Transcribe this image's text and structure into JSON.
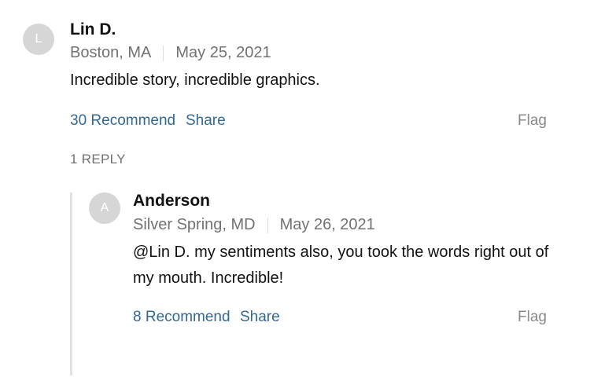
{
  "comment": {
    "avatar_initial": "L",
    "author": "Lin D.",
    "location": "Boston, MA",
    "date": "May 25, 2021",
    "text": "Incredible story, incredible graphics.",
    "recommend_label": "30 Recommend",
    "share_label": "Share",
    "flag_label": "Flag",
    "replies_label": "1 REPLY"
  },
  "reply": {
    "avatar_initial": "A",
    "author": "Anderson",
    "location": "Silver Spring, MD",
    "date": "May 26, 2021",
    "text": "@Lin D. my sentiments also, you took the words right out of my mouth.  Incredible!",
    "recommend_label": "8 Recommend",
    "share_label": "Share",
    "flag_label": "Flag"
  },
  "colors": {
    "link": "#326891",
    "muted": "#727272",
    "avatar_bg": "#d6d6d6",
    "thread_line": "#e2e2e2"
  }
}
